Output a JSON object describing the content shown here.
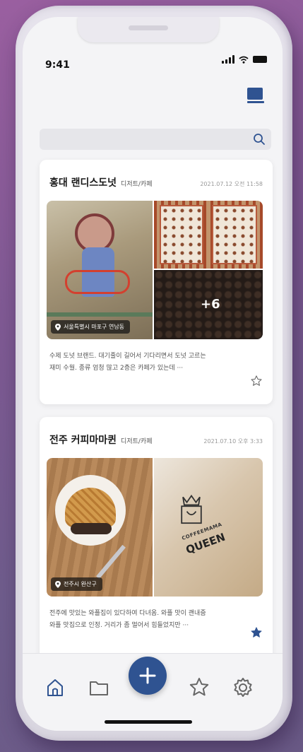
{
  "status_bar": {
    "time": "9:41"
  },
  "search": {
    "placeholder": "",
    "value": ""
  },
  "posts": [
    {
      "title": "홍대 랜디스도넛",
      "category": "디저트/카페",
      "date": "2021.07.12 오전 11:58",
      "location": "서울특별시 마포구 연남동",
      "more_photos": "+6",
      "description_line1": "수제 도넛 브랜드. 대기줄이 길어서 기다리면서 도넛 고르는",
      "description_line2": "재미 수월. 종류 엄청 많고 2층은 카페가 있는데 ···",
      "favorite": false
    },
    {
      "title": "전주 커피마마퀸",
      "category": "디저트/카페",
      "date": "2021.07.10 오후 3:33",
      "location": "전주시 완산구",
      "photo_text_brand": "COFFEEMAMA",
      "photo_text_queen": "QUEEN",
      "description_line1": "전주에 맛있는 와플집이 있다하여 다녀옴. 와플 맛이 괜내줌",
      "description_line2": "와플 맛집으로 인정. 거리가 좀 멀어서 힘들었지만 ···",
      "favorite": true
    }
  ],
  "tab_bar": {
    "items": [
      "home-icon",
      "folder-icon",
      "add-icon",
      "star-icon",
      "settings-icon"
    ]
  },
  "colors": {
    "accent": "#2f5391",
    "background": "#f4f4f6"
  }
}
